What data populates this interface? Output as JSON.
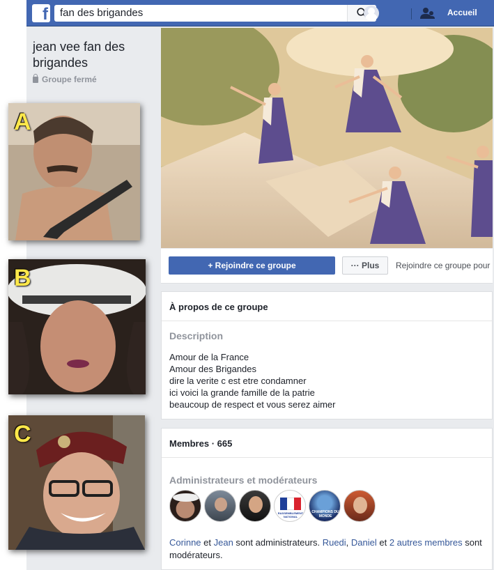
{
  "topbar": {
    "logo_letter": "f",
    "search_value": "fan des brigandes",
    "home_label": "Accueil"
  },
  "group": {
    "name": "jean vee fan des brigandes",
    "privacy": "Groupe fermé"
  },
  "actions": {
    "join_label": "+ Rejoindre ce groupe",
    "more_label": "··· Plus",
    "join_hint": "Rejoindre ce groupe pour"
  },
  "about": {
    "title": "À propos de ce groupe",
    "description_heading": "Description",
    "description_lines": [
      "Amour de la France",
      "Amour des Brigandes",
      "dire la verite c est etre condamner",
      "ici voici la grande famille de la patrie",
      "beaucoup de respect et vous serez aimer"
    ]
  },
  "members": {
    "title": "Membres · 665",
    "admins_heading": "Administrateurs et modérateurs",
    "admin_badge_1": "RASSEMBLEMENT NATIONAL",
    "admin_badge_2": "CHAMPIONS DU MONDE",
    "sentence": {
      "admin1": "Corinne",
      "and1": " et ",
      "admin2": "Jean",
      "part1": " sont administrateurs. ",
      "mod1": "Ruedi",
      "comma": ", ",
      "mod2": "Daniel",
      "and2": " et ",
      "mod_others": "2 autres membres",
      "part2": " sont modérateurs."
    }
  },
  "overlay_labels": {
    "a": "A",
    "b": "B",
    "c": "C"
  },
  "colors": {
    "facebook_blue": "#4267b2",
    "link": "#365899",
    "label_yellow": "#ffe84a"
  }
}
